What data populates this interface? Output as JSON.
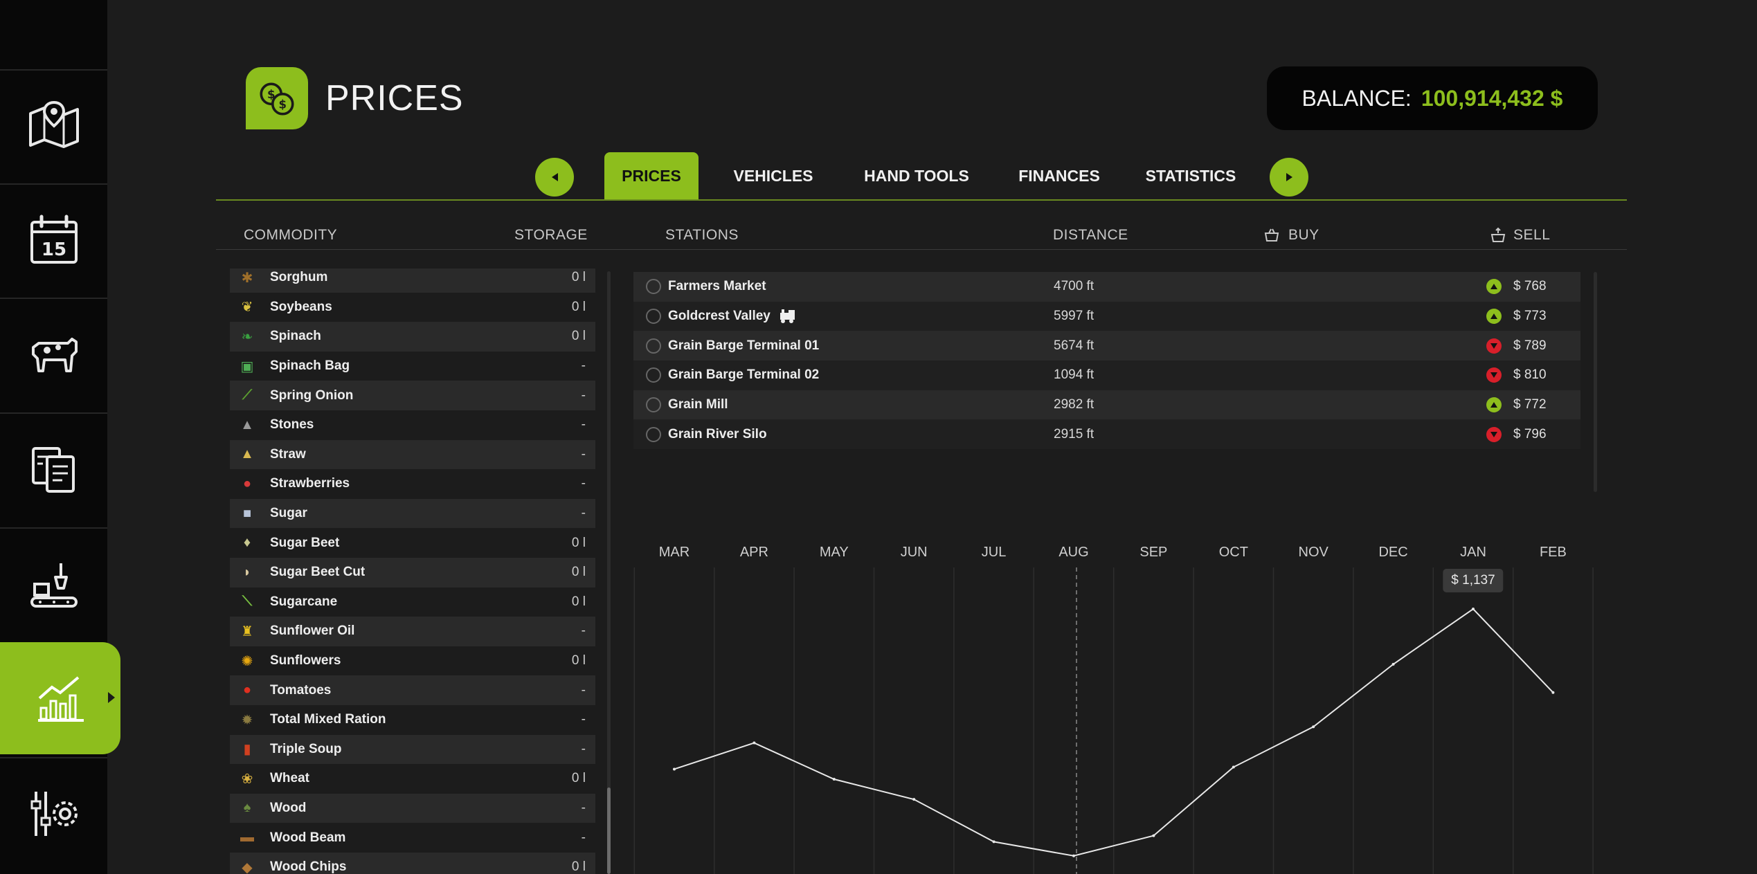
{
  "header": {
    "title": "PRICES",
    "balance_label": "BALANCE:",
    "balance_value": "100,914,432 $"
  },
  "sidebar": {
    "items": [
      {
        "icon": "map-icon",
        "active": false
      },
      {
        "icon": "calendar-icon",
        "label": "15",
        "active": false
      },
      {
        "icon": "cow-icon",
        "active": false
      },
      {
        "icon": "contracts-icon",
        "active": false
      },
      {
        "icon": "production-icon",
        "active": false
      },
      {
        "icon": "prices-chart-icon",
        "active": true
      },
      {
        "icon": "settings-icon",
        "active": false
      }
    ]
  },
  "tabs": [
    "PRICES",
    "VEHICLES",
    "HAND TOOLS",
    "FINANCES",
    "STATISTICS"
  ],
  "columns": {
    "commodity": "COMMODITY",
    "storage": "STORAGE",
    "stations": "STATIONS",
    "distance": "DISTANCE",
    "buy": "BUY",
    "sell": "SELL"
  },
  "commodities": [
    {
      "name": "Sorghum",
      "storage": "0 l",
      "icon": "sorghum-icon",
      "color": "#a0702a",
      "glyph": "✱"
    },
    {
      "name": "Soybeans",
      "storage": "0 l",
      "icon": "soybeans-icon",
      "color": "#d8c040",
      "glyph": "❦"
    },
    {
      "name": "Spinach",
      "storage": "0 l",
      "icon": "spinach-icon",
      "color": "#3aa040",
      "glyph": "❧"
    },
    {
      "name": "Spinach Bag",
      "storage": "-",
      "icon": "spinach-bag-icon",
      "color": "#4fae55",
      "glyph": "▣"
    },
    {
      "name": "Spring Onion",
      "storage": "-",
      "icon": "spring-onion-icon",
      "color": "#5ca030",
      "glyph": "⟋"
    },
    {
      "name": "Stones",
      "storage": "-",
      "icon": "stones-icon",
      "color": "#9a9a9a",
      "glyph": "▲"
    },
    {
      "name": "Straw",
      "storage": "-",
      "icon": "straw-icon",
      "color": "#d8b850",
      "glyph": "▲"
    },
    {
      "name": "Strawberries",
      "storage": "-",
      "icon": "strawberries-icon",
      "color": "#d83a3a",
      "glyph": "●"
    },
    {
      "name": "Sugar",
      "storage": "-",
      "icon": "sugar-icon",
      "color": "#b8c4d8",
      "glyph": "■"
    },
    {
      "name": "Sugar Beet",
      "storage": "0 l",
      "icon": "sugar-beet-icon",
      "color": "#c8c890",
      "glyph": "♦"
    },
    {
      "name": "Sugar Beet Cut",
      "storage": "0 l",
      "icon": "sugar-beet-cut-icon",
      "color": "#d8c8a0",
      "glyph": "◗"
    },
    {
      "name": "Sugarcane",
      "storage": "0 l",
      "icon": "sugarcane-icon",
      "color": "#78c040",
      "glyph": "⟍"
    },
    {
      "name": "Sunflower Oil",
      "storage": "-",
      "icon": "sunflower-oil-icon",
      "color": "#e8c020",
      "glyph": "♜"
    },
    {
      "name": "Sunflowers",
      "storage": "0 l",
      "icon": "sunflowers-icon",
      "color": "#e8a810",
      "glyph": "✺"
    },
    {
      "name": "Tomatoes",
      "storage": "-",
      "icon": "tomatoes-icon",
      "color": "#e03020",
      "glyph": "●"
    },
    {
      "name": "Total Mixed Ration",
      "storage": "-",
      "icon": "total-mixed-ration-icon",
      "color": "#8a7a40",
      "glyph": "✹"
    },
    {
      "name": "Triple Soup",
      "storage": "-",
      "icon": "triple-soup-icon",
      "color": "#d04020",
      "glyph": "▮"
    },
    {
      "name": "Wheat",
      "storage": "0 l",
      "icon": "wheat-icon",
      "color": "#d8b040",
      "glyph": "❀"
    },
    {
      "name": "Wood",
      "storage": "-",
      "icon": "wood-icon",
      "color": "#6a8a40",
      "glyph": "♠"
    },
    {
      "name": "Wood Beam",
      "storage": "-",
      "icon": "wood-beam-icon",
      "color": "#a06a30",
      "glyph": "▬"
    },
    {
      "name": "Wood Chips",
      "storage": "0 l",
      "icon": "wood-chips-icon",
      "color": "#b07838",
      "glyph": "◆"
    }
  ],
  "stations": [
    {
      "name": "Farmers Market",
      "distance": "4700 ft",
      "trend": "up",
      "price": "$ 768",
      "train": false
    },
    {
      "name": "Goldcrest Valley",
      "distance": "5997 ft",
      "trend": "up",
      "price": "$ 773",
      "train": true
    },
    {
      "name": "Grain Barge Terminal 01",
      "distance": "5674 ft",
      "trend": "down",
      "price": "$ 789",
      "train": false
    },
    {
      "name": "Grain Barge Terminal 02",
      "distance": "1094 ft",
      "trend": "down",
      "price": "$ 810",
      "train": false
    },
    {
      "name": "Grain Mill",
      "distance": "2982 ft",
      "trend": "up",
      "price": "$ 772",
      "train": false
    },
    {
      "name": "Grain River Silo",
      "distance": "2915 ft",
      "trend": "down",
      "price": "$ 796",
      "train": false
    }
  ],
  "colors": {
    "accent": "#8dbe1d",
    "trend_up": "#8dbe1d",
    "trend_down": "#d81f2a"
  },
  "chart_data": {
    "type": "line",
    "categories": [
      "MAR",
      "APR",
      "MAY",
      "JUN",
      "JUL",
      "AUG",
      "SEP",
      "OCT",
      "NOV",
      "DEC",
      "JAN",
      "FEB"
    ],
    "values": [
      740,
      805,
      715,
      665,
      560,
      525,
      575,
      745,
      845,
      1000,
      1137,
      930
    ],
    "ylim": [
      480,
      1240
    ],
    "current_month": "AUG",
    "highlight": {
      "category": "JAN",
      "label": "$ 1,137"
    },
    "grid": "vertical"
  }
}
